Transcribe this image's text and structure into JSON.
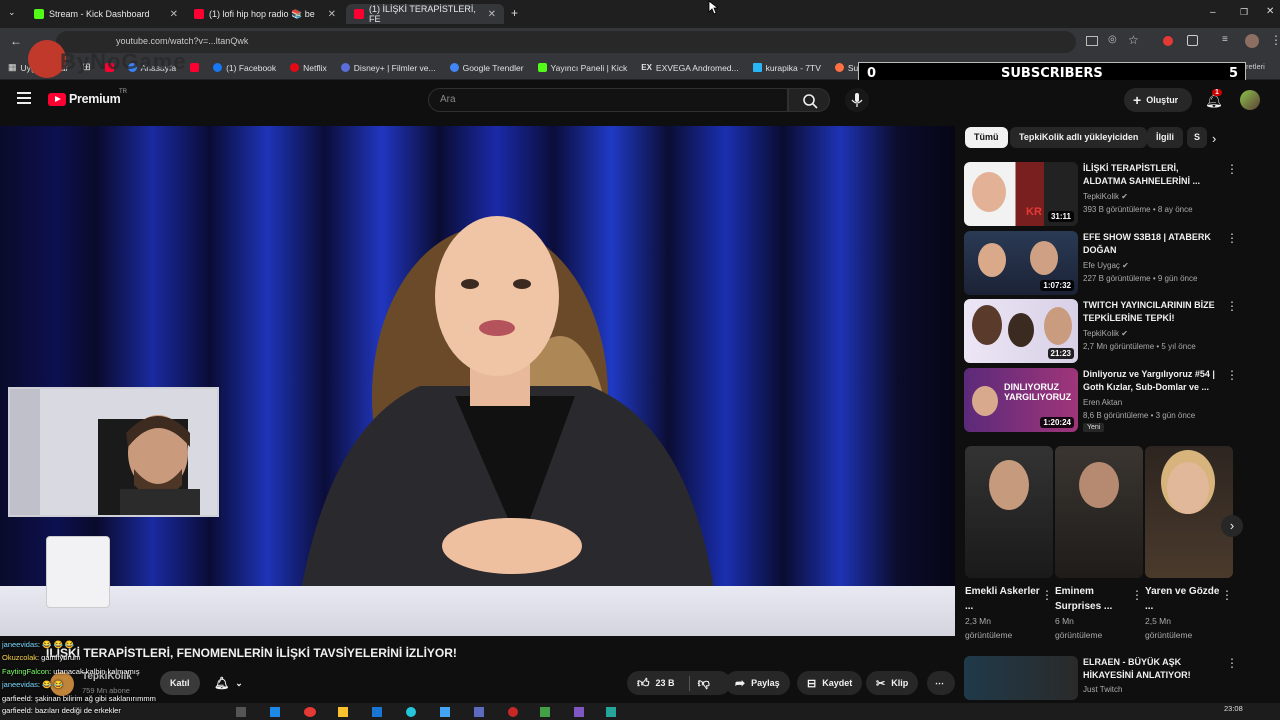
{
  "tabs": [
    {
      "label": "Stream - Kick Dashboard",
      "color": "#53fc18"
    },
    {
      "label": "(1) lofi hip hop radio 📚 be",
      "color": "#ff0033"
    },
    {
      "label": "(1) İLİŞKİ TERAPİSTLERİ, FE",
      "color": "#ff0033"
    }
  ],
  "address": {
    "url": "youtube.com/watch?v=...ltanQwk",
    "overlay_logo": "ByNoGame"
  },
  "bookmarks": [
    "Uygulamalar",
    "Anasayfa",
    "(1) Facebook",
    "Netflix",
    "Disney+ | Filmler ve...",
    "Google Trendler",
    "Yayıncı Paneli | Kick",
    "EXVEGA Andromed...",
    "kurapika - 7TV",
    "Suno | AI Musi"
  ],
  "bookmarks_end": "Tüm Yer İşaretleri",
  "subscribers": {
    "left": "0",
    "label": "SUBSCRIBERS",
    "right": "5"
  },
  "youtube": {
    "logo": "Premium",
    "region": "TR",
    "search_placeholder": "Ara",
    "create_label": "Oluştur",
    "notifications": "1"
  },
  "chips": [
    "Tümü",
    "TepkiKolik adlı yükleyiciden",
    "İlgili",
    "S"
  ],
  "recommendations": [
    {
      "title": "İLİŞKİ TERAPİSTLERİ, ALDATMA SAHNELERİNİ ...",
      "channel": "TepkiKolik",
      "meta": "393 B görüntüleme • 8 ay önce",
      "duration": "31:11",
      "badge": ""
    },
    {
      "title": "EFE SHOW S3B18 | ATABERK DOĞAN",
      "channel": "Efe Uygaç",
      "meta": "227 B görüntüleme • 9 gün önce",
      "duration": "1:07:32",
      "badge": ""
    },
    {
      "title": "TWITCH YAYINCILARININ BİZE TEPKİLERİNE TEPKİ!",
      "channel": "TepkiKolik",
      "meta": "2,7 Mn görüntüleme • 5 yıl önce",
      "duration": "21:23",
      "badge": ""
    },
    {
      "title": "Dinliyoruz ve Yargılıyoruz #54 | Goth Kızlar, Sub-Domlar ve ...",
      "channel": "Eren Aktan",
      "meta": "8,6 B görüntüleme • 3 gün önce",
      "duration": "1:20:24",
      "badge": "Yeni"
    }
  ],
  "shorts": [
    {
      "title": "Emekli Askerler ...",
      "views": "2,3 Mn",
      "suffix": "görüntüleme"
    },
    {
      "title": "Eminem Surprises ...",
      "views": "6 Mn",
      "suffix": "görüntüleme"
    },
    {
      "title": "Yaren ve Gözde ...",
      "views": "2,5 Mn",
      "suffix": "görüntüleme"
    }
  ],
  "last_rec": {
    "title": "ELRAEN - BÜYÜK AŞK HİKAYESİNİ ANLATIYOR!",
    "channel": "Just Twitch"
  },
  "video": {
    "title": "İLİŞKİ TERAPİSTLERİ, FENOMENLERİN İLİŞKİ TAVSİYELERİNİ İZLİYOR!",
    "channel": "TepkiKolik",
    "subs": "759 Mn abone",
    "join": "Katıl",
    "likes": "23 B",
    "share": "Paylaş",
    "save": "Kaydet",
    "clip": "Klip"
  },
  "chat": [
    {
      "user": "janeevidas",
      "text": ": 😂 😂 😂",
      "color": "#7ad7ff"
    },
    {
      "user": "Okuzcolak",
      "text": ": gamlıyorum",
      "color": "#ffd84a"
    },
    {
      "user": "FaytingFalcon",
      "text": ": utanacak kalbin kalmamış",
      "color": "#7dff6a"
    },
    {
      "user": "janeevidas",
      "text": ": 😂 😂",
      "color": "#7ad7ff"
    },
    {
      "user": "garfieeld",
      "text": ": şakinan bilirim ağ gibi saklanırımmm",
      "color": "#ffffff"
    },
    {
      "user": "garfieeld",
      "text": ": bazıları dediği de erkekler",
      "color": "#ffffff"
    }
  ],
  "clock": "23:08"
}
